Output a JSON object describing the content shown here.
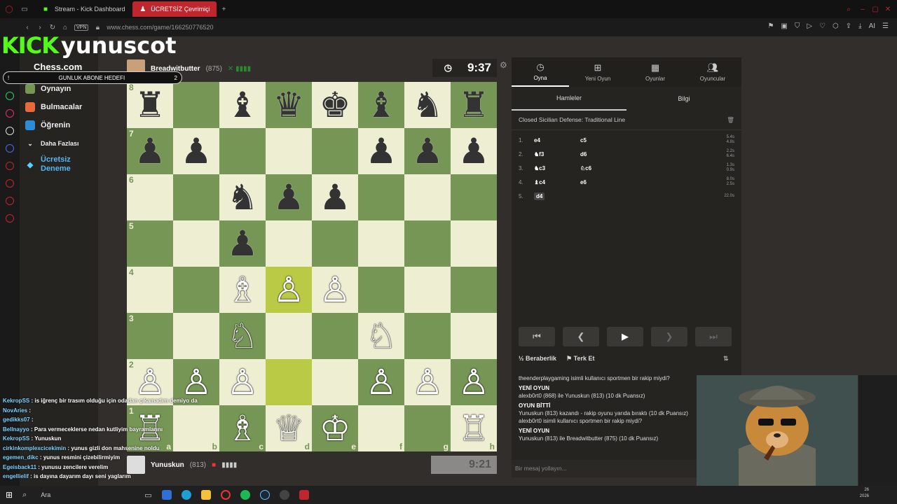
{
  "browser": {
    "tabs": [
      {
        "title": "Stream - Kick Dashboard",
        "active": false
      },
      {
        "title": "ÜCRETSİZ Çevrimiçi Satra",
        "active": true
      }
    ],
    "url": "www.chess.com/game/166250776520",
    "vpn": "VPN"
  },
  "overlay": {
    "kick_logo": "KICK",
    "channel": "yunuscot",
    "goal_label": "GUNLUK ABONE HEDEFI",
    "goal_count": "2"
  },
  "sidebar": {
    "logo": "Chess.com",
    "items": [
      {
        "label": "Oynayın"
      },
      {
        "label": "Bulmacalar"
      },
      {
        "label": "Öğrenin"
      },
      {
        "label": "Daha Fazlası"
      },
      {
        "label": "Ücretsiz Deneme"
      }
    ]
  },
  "top_player": {
    "name": "Breadwitbutter",
    "rating": "(875)",
    "clock": "9:37"
  },
  "bottom_player": {
    "name": "Yunuskun",
    "rating": "(813)",
    "clock": "9:21"
  },
  "board": {
    "files": [
      "a",
      "b",
      "c",
      "d",
      "e",
      "f",
      "g",
      "h"
    ],
    "ranks": [
      "8",
      "7",
      "6",
      "5",
      "4",
      "3",
      "2",
      "1"
    ],
    "position": [
      [
        "br",
        "",
        "bb",
        "bq",
        "bk",
        "bb",
        "bn",
        "br"
      ],
      [
        "bp",
        "bp",
        "",
        "",
        "",
        "bp",
        "bp",
        "bp"
      ],
      [
        "",
        "",
        "bn",
        "bp",
        "bp",
        "",
        "",
        ""
      ],
      [
        "",
        "",
        "bp",
        "",
        "",
        "",
        "",
        ""
      ],
      [
        "",
        "",
        "wb",
        "wp",
        "wp",
        "",
        "",
        ""
      ],
      [
        "",
        "",
        "wn",
        "",
        "",
        "wn",
        "",
        ""
      ],
      [
        "wp",
        "wp",
        "wp",
        "",
        "",
        "wp",
        "wp",
        "wp"
      ],
      [
        "wr",
        "",
        "wb",
        "wq",
        "wk",
        "",
        "",
        "wr"
      ]
    ],
    "highlight": [
      "d2",
      "d4"
    ]
  },
  "panel": {
    "tabs": [
      {
        "label": "Oyna",
        "icon": "stopwatch-icon"
      },
      {
        "label": "Yeni Oyun",
        "icon": "plus-icon"
      },
      {
        "label": "Oyunlar",
        "icon": "board-icon"
      },
      {
        "label": "Oyuncular",
        "icon": "players-icon"
      }
    ],
    "subtabs": [
      "Hamleler",
      "Bilgi"
    ],
    "opening": "Closed Sicilian Defense: Traditional Line",
    "moves": [
      {
        "n": "1.",
        "w": "e4",
        "b": "c5",
        "t1": "5.4s",
        "t2": "4.8s"
      },
      {
        "n": "2.",
        "w": "♞f3",
        "b": "d6",
        "t1": "2.2s",
        "t2": "6.4s"
      },
      {
        "n": "3.",
        "w": "♞c3",
        "b": "♘c6",
        "t1": "1.3s",
        "t2": "0.9s"
      },
      {
        "n": "4.",
        "w": "♝c4",
        "b": "e6",
        "t1": "8.0s",
        "t2": "2.5s"
      },
      {
        "n": "5.",
        "w": "d4",
        "b": "",
        "t1": "22.0s",
        "t2": ""
      }
    ],
    "draw": "Beraberlik",
    "resign": "Terk Et",
    "log": [
      {
        "text": "theenderplaygaming isimli kullanıcı sportmen bir rakip miydi?",
        "head": false
      },
      {
        "text": "YENİ OYUN",
        "head": true
      },
      {
        "text": "alexb0rt0 (868) ile Yunuskun (813) (10 dk Puansız)",
        "head": false
      },
      {
        "text": "OYUN BİTTİ",
        "head": true
      },
      {
        "text": "Yunuskun (813) kazandı - rakip oyunu yarıda bıraktı (10 dk Puansız)",
        "head": false
      },
      {
        "text": "alexb0rt0 isimli kullanıcı sportmen bir rakip miydi?",
        "head": false
      },
      {
        "text": "YENİ OYUN",
        "head": true
      },
      {
        "text": "Yunuskun (813) ile Breadwitbutter (875) (10 dk Puansız)",
        "head": false
      }
    ],
    "chat_placeholder": "Bir mesaj yollayın..."
  },
  "chat": [
    {
      "user": "KekropSS",
      "msg": "is iğrenç bir trasım olduğu için odadan çıkamadım demiyo da"
    },
    {
      "user": "NovAries",
      "msg": ""
    },
    {
      "user": "gedikks07",
      "msg": ""
    },
    {
      "user": "Bellnayyo",
      "msg": "Para vermeceklerse nedan kutliyim bayramlarını"
    },
    {
      "user": "KekropSS",
      "msg": "Yunuskun"
    },
    {
      "user": "cirkinkomplexcicekimin",
      "msg": "yunus gizli don mahsenine noldu"
    },
    {
      "user": "egemen_dikc",
      "msg": "yunus resmini çizebilirmiyim"
    },
    {
      "user": "Egeisback11",
      "msg": "yunusu zencilere verelim"
    },
    {
      "user": "engellielif",
      "msg": "is dayına dayarım dayı seni yaglarım"
    }
  ],
  "taskbar": {
    "search": "Ara",
    "date_line1": "26",
    "date_line2": "2026"
  }
}
